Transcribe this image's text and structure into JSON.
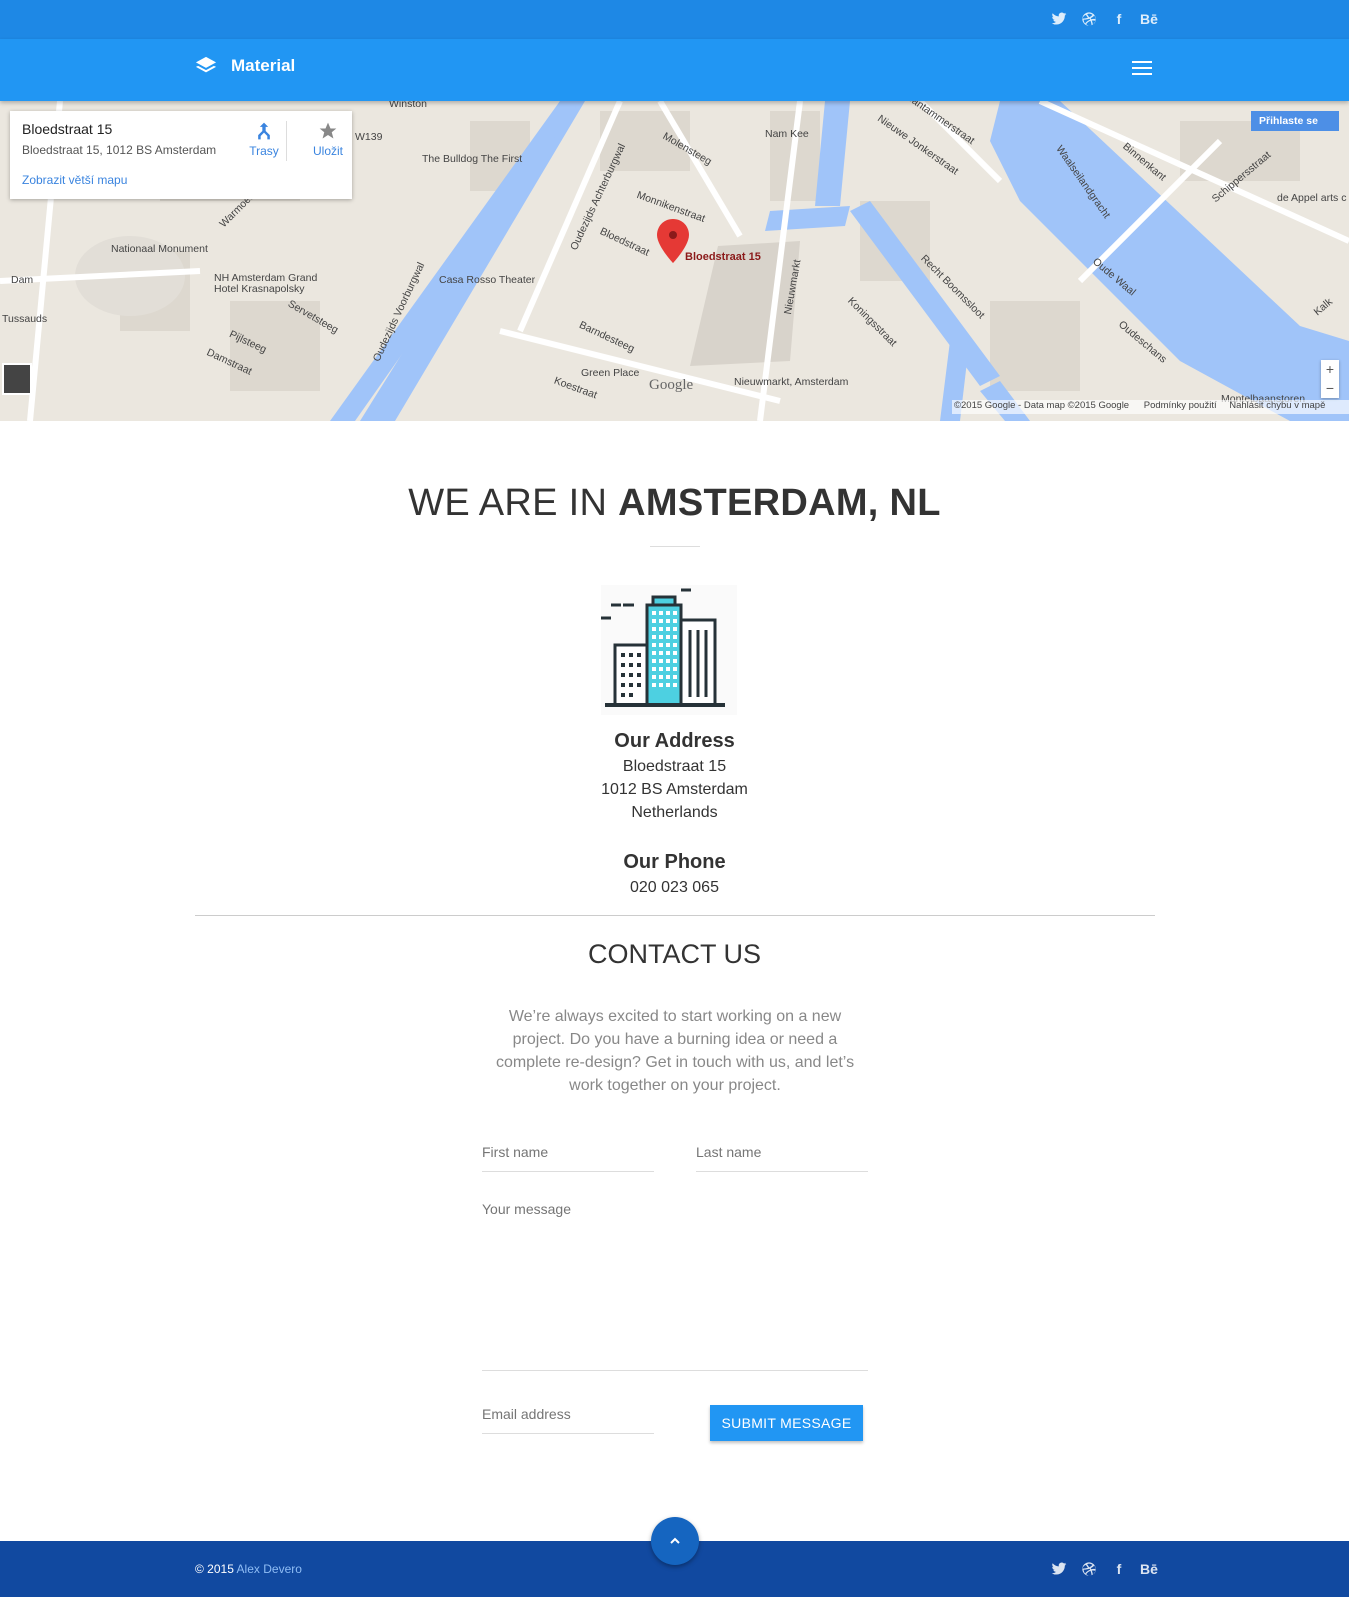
{
  "header": {
    "brand": "Material",
    "social_icons": [
      "twitter-icon",
      "dribbble-icon",
      "facebook-icon",
      "behance-icon"
    ],
    "behance_label": "Bē",
    "facebook_label": "f"
  },
  "map": {
    "card": {
      "title": "Bloedstraat 15",
      "address": "Bloedstraat 15, 1012 BS Amsterdam",
      "directions": "Trasy",
      "save": "Uložit",
      "bigger_map": "Zobrazit větší mapu"
    },
    "marker_label": "Bloedstraat 15",
    "signin": "Přihlaste se",
    "footer": "©2015 Google - Data map ©2015 Google",
    "terms": "Podmínky použití",
    "report": "Nahlásit chybu v mapě",
    "labels": [
      "Winston",
      "W139",
      "The Bulldog The First",
      "Molensteeg",
      "Nam Kee",
      "Nieuwe Jonkerstraat",
      "Bantammerstraat",
      "Waalseilandgracht",
      "Binnenkant",
      "Schippersstraat",
      "de Appel arts c",
      "Oudezijds Voorburgwal",
      "Oudezijds Achterburgwal",
      "Monnikenstraat",
      "Bloedstraat",
      "Nationaal Monument",
      "NH Amsterdam Grand Hotel Krasnapolsky",
      "Casa Rosso Theater",
      "Dam",
      "Tussauds",
      "Servetsteeg",
      "Pijlsteeg",
      "Damstraat",
      "Barndesteeg",
      "Green Place",
      "Koestraat",
      "Nieuwmarkt",
      "Koningsstraat",
      "Recht Boomssloot",
      "Oude Waal",
      "Oudeschans",
      "Nieuwmarkt, Amsterdam",
      "Montelbaanstoren",
      "Warmoes",
      "Kalk"
    ],
    "google_logo": "Google",
    "zoom_in": "+",
    "zoom_out": "−"
  },
  "location": {
    "heading_light": "WE ARE IN ",
    "heading_bold": "AMSTERDAM, NL",
    "address_title": "Our Address",
    "address_lines": [
      "Bloedstraat 15",
      "1012 BS Amsterdam",
      "Netherlands"
    ],
    "phone_title": "Our Phone",
    "phone": "020 023 065"
  },
  "contact": {
    "heading": "CONTACT US",
    "intro": "We’re always excited to start working on a new project. Do you have a burning idea or need a complete re-design? Get in touch with us, and let’s work together on your project.",
    "first_name_placeholder": "First name",
    "last_name_placeholder": "Last name",
    "message_placeholder": "Your message",
    "email_placeholder": "Email address",
    "submit": "SUBMIT MESSAGE"
  },
  "footer": {
    "copyright": "© 2015 ",
    "author": "Alex Devero"
  },
  "colors": {
    "topbar": "#1e88e5",
    "navbar": "#2196f3",
    "footer": "#1149a0",
    "accent": "#2196f3",
    "building_accent": "#4dd0e1"
  }
}
